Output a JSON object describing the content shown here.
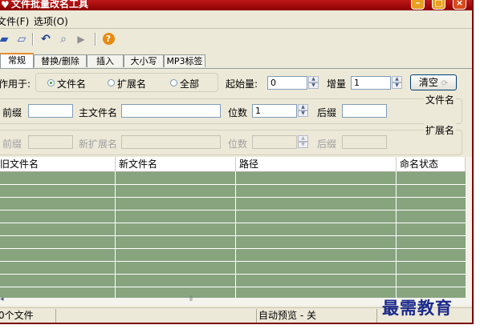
{
  "window": {
    "title": "文件批量改名工具",
    "controls": {
      "minimize": "–",
      "maximize": "□",
      "close": "×"
    }
  },
  "menu": {
    "items": [
      {
        "label": "文件(F)"
      },
      {
        "label": "选项(O)"
      }
    ]
  },
  "toolbar": {
    "icons": [
      "open-folder-icon",
      "open-file-icon",
      "undo-icon",
      "preview-icon",
      "run-icon",
      "help-icon"
    ]
  },
  "tabs": [
    {
      "label": "常规",
      "active": true
    },
    {
      "label": "替换/删除"
    },
    {
      "label": "插入"
    },
    {
      "label": "大小写"
    },
    {
      "label": "MP3标签"
    }
  ],
  "apply": {
    "label": "作用于:",
    "options": [
      {
        "label": "文件名",
        "selected": true
      },
      {
        "label": "扩展名"
      },
      {
        "label": "全部"
      }
    ]
  },
  "start": {
    "label": "起始量:",
    "value": "0"
  },
  "increment": {
    "label": "增量",
    "value": "1"
  },
  "clear_button": "清空",
  "filename_group": {
    "title": "文件名",
    "prefix_label": "前缀",
    "prefix_value": "",
    "main_label": "主文件名",
    "main_value": "",
    "digits_label": "位数",
    "digits_value": "1",
    "suffix_label": "后缀",
    "suffix_value": ""
  },
  "extension_group": {
    "title": "扩展名",
    "prefix_label": "前缀",
    "new_ext_label": "新扩展名",
    "digits_label": "位数",
    "suffix_label": "后缀"
  },
  "grid": {
    "columns": [
      "旧文件名",
      "新文件名",
      "路径",
      "命名状态"
    ],
    "row_count_visible": 10
  },
  "status": {
    "file_count": "0个文件",
    "preview": "自动预览 - 关"
  },
  "watermark": "最需教育",
  "colors": {
    "title_bar": "#a80f0f",
    "grid_bg": "#87a47f",
    "tab_accent": "#e68b2c"
  }
}
